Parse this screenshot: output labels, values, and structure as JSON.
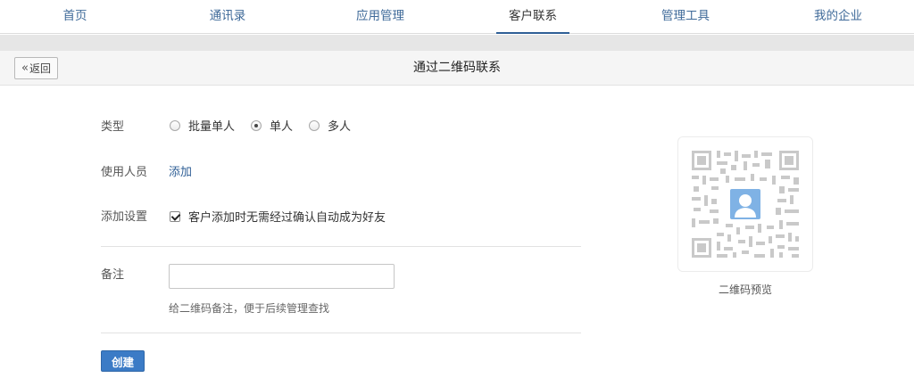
{
  "nav": {
    "items": [
      {
        "label": "首页",
        "active": false
      },
      {
        "label": "通讯录",
        "active": false
      },
      {
        "label": "应用管理",
        "active": false
      },
      {
        "label": "客户联系",
        "active": true
      },
      {
        "label": "管理工具",
        "active": false
      },
      {
        "label": "我的企业",
        "active": false
      }
    ]
  },
  "header": {
    "back_label": "返回",
    "back_icon": "double-chevron-left-icon",
    "title": "通过二维码联系"
  },
  "form": {
    "type_label": "类型",
    "type_options": [
      {
        "label": "批量单人",
        "checked": false
      },
      {
        "label": "单人",
        "checked": true
      },
      {
        "label": "多人",
        "checked": false
      }
    ],
    "users_label": "使用人员",
    "users_add_link": "添加",
    "settings_label": "添加设置",
    "settings_checkbox_label": "客户添加时无需经过确认自动成为好友",
    "settings_checked": true,
    "remark_label": "备注",
    "remark_value": "",
    "remark_placeholder": "",
    "remark_hint": "给二维码备注，便于后续管理查找",
    "create_button": "创建"
  },
  "preview": {
    "caption": "二维码预览",
    "avatar_icon": "person-icon"
  },
  "colors": {
    "link": "#2f5f96",
    "primary_button": "#3b7bc6"
  }
}
